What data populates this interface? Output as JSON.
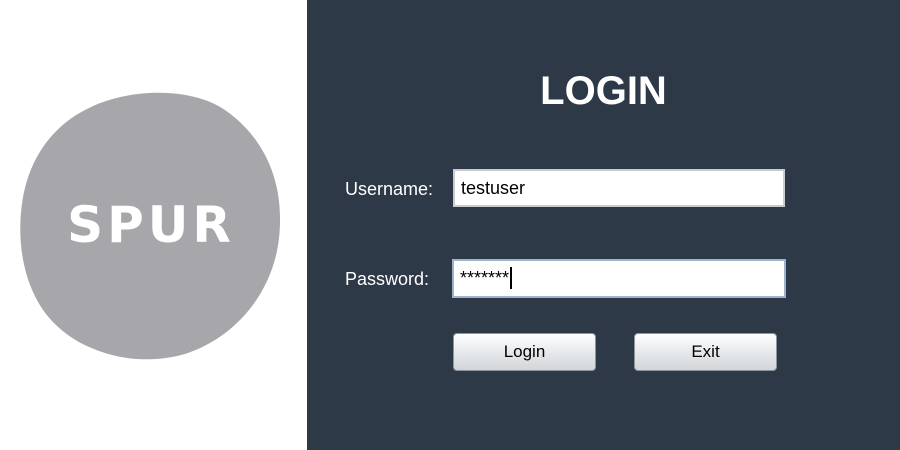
{
  "logo": {
    "text": "SPUR",
    "color": "#a7a6aa"
  },
  "login": {
    "title": "LOGIN",
    "username_label": "Username:",
    "username_value": "testuser",
    "password_label": "Password:",
    "password_value": "*******",
    "login_button": "Login",
    "exit_button": "Exit"
  },
  "colors": {
    "panel_bg": "#2d3947",
    "text": "#ffffff"
  }
}
